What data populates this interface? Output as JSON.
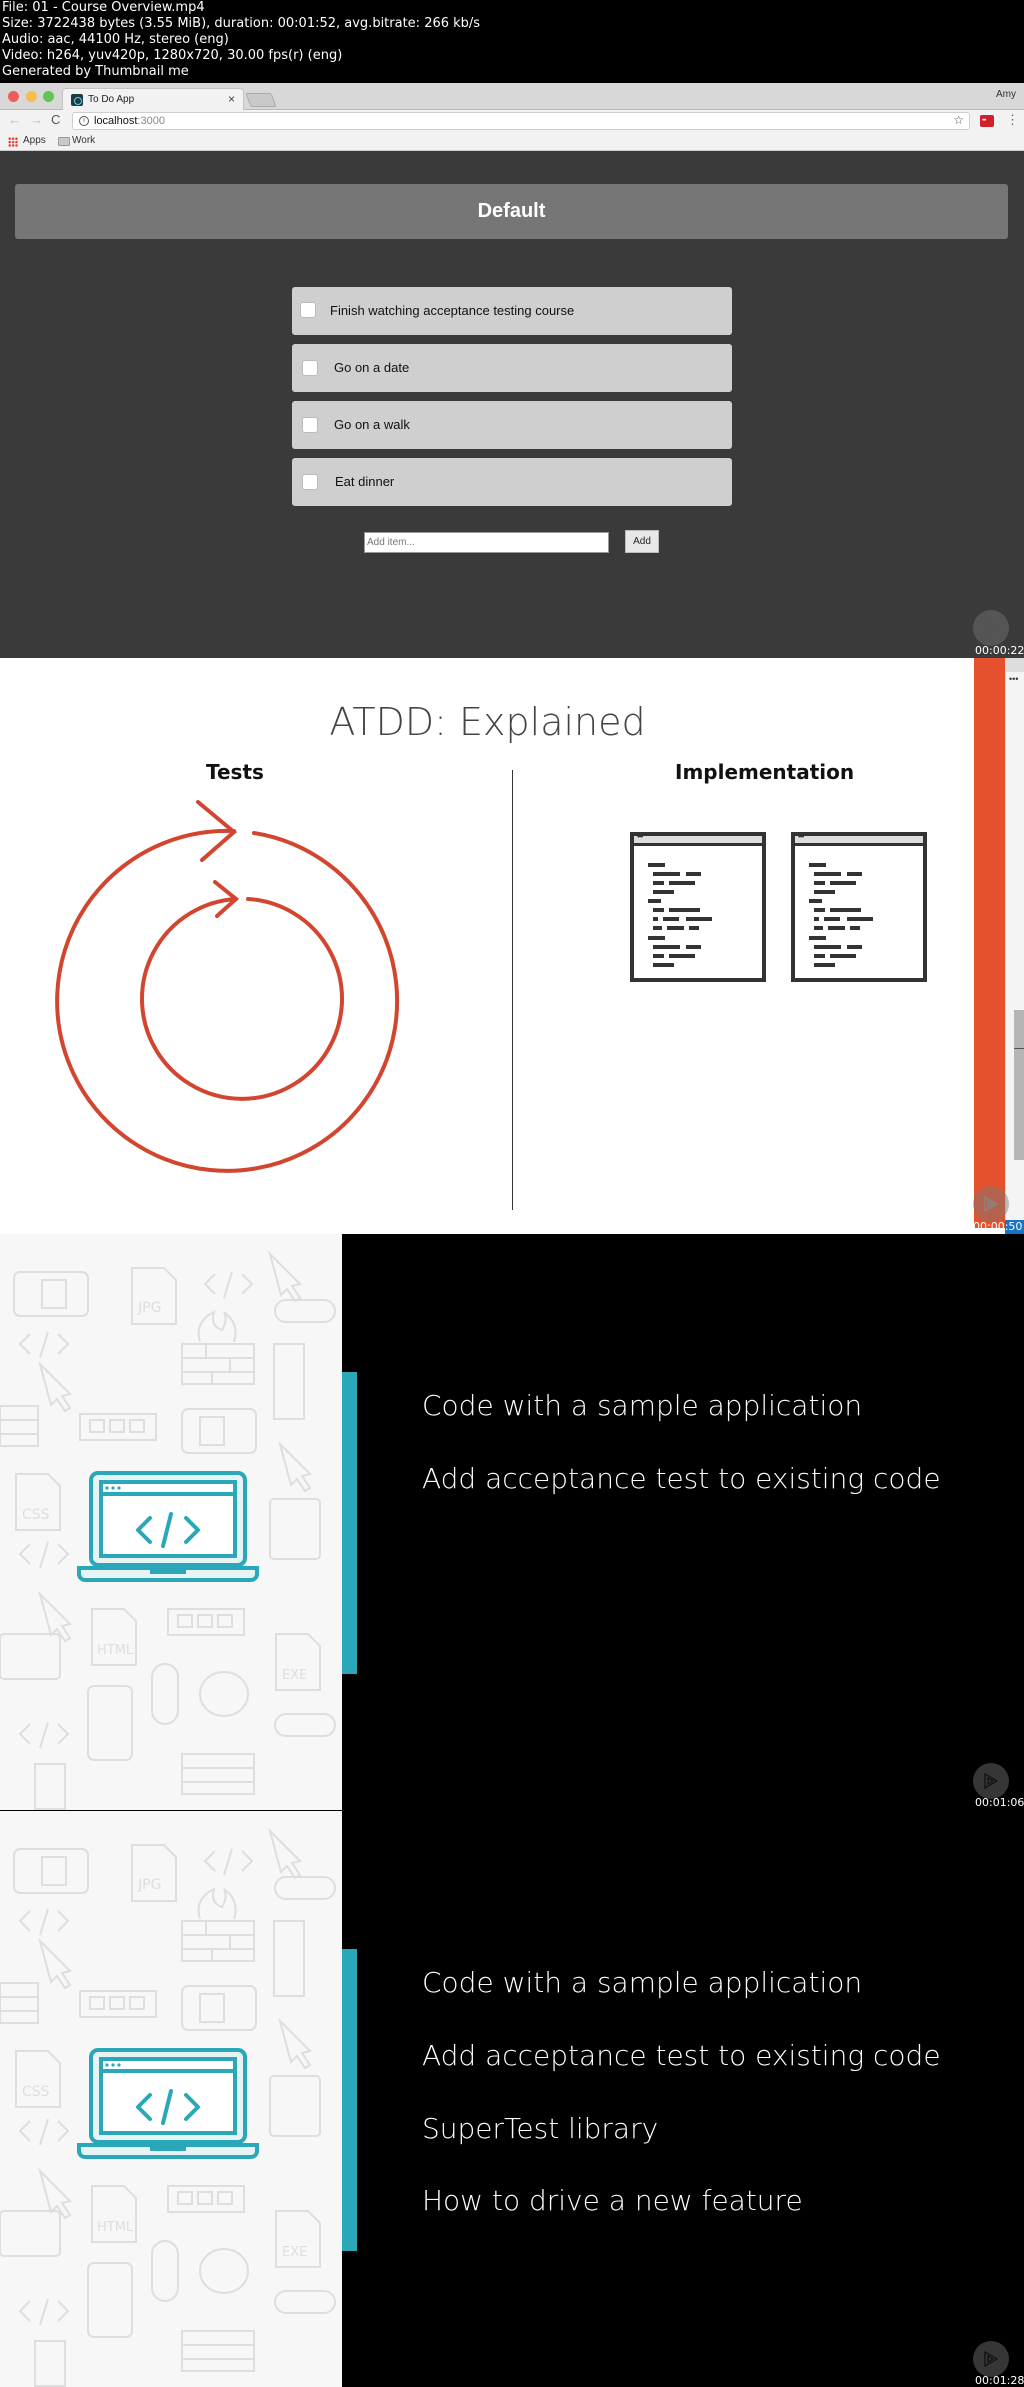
{
  "meta": {
    "lines": [
      "File: 01 - Course Overview.mp4",
      "Size: 3722438 bytes (3.55 MiB), duration: 00:01:52, avg.bitrate: 266 kb/s",
      "Audio: aac, 44100 Hz, stereo (eng)",
      "Video: h264, yuv420p, 1280x720, 30.00 fps(r) (eng)",
      "Generated by Thumbnail me"
    ]
  },
  "frames": [
    {
      "timestamp": "00:00:22",
      "browser": {
        "tab_title": "To Do App",
        "tab_close": "×",
        "profile": "Amy",
        "url_host": "localhost",
        "url_port": ":3000",
        "bookmarks": [
          "Apps",
          "Work"
        ],
        "icons": {
          "back": "←",
          "forward": "→",
          "reload": "C",
          "info": "i",
          "star": "☆",
          "menu": "⋮"
        }
      },
      "app": {
        "header": "Default",
        "todos": [
          {
            "label": "Finish watching acceptance testing course",
            "checked": false
          },
          {
            "label": "Go on a date",
            "checked": false
          },
          {
            "label": "Go on a walk",
            "checked": false
          },
          {
            "label": "Eat dinner",
            "checked": false
          }
        ],
        "add_placeholder": "Add item...",
        "add_button": "Add"
      }
    },
    {
      "timestamp": "00:00:50",
      "slide": {
        "title": "ATDD: Explained",
        "left_heading": "Tests",
        "right_heading": "Implementation",
        "side_dots": "•••",
        "accent_color": "#e4512c"
      }
    },
    {
      "timestamp": "00:01:06",
      "bullets": [
        "Code with a sample application",
        "Add acceptance test to existing code"
      ],
      "accent_color": "#2aa7b8"
    },
    {
      "timestamp": "00:01:28",
      "bullets": [
        "Code with a sample application",
        "Add acceptance test to existing code",
        "SuperTest library",
        "How to drive a new feature"
      ],
      "accent_color": "#2aa7b8"
    }
  ]
}
